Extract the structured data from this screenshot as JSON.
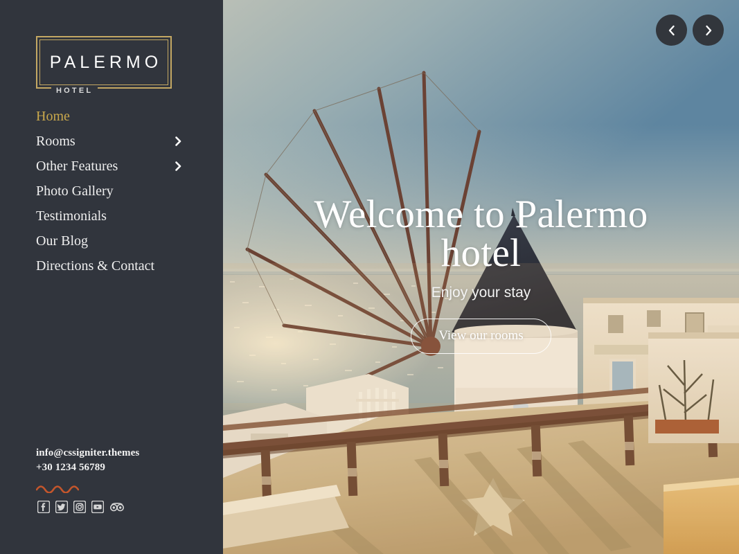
{
  "brand": {
    "name": "PALERMO",
    "sub": "HOTEL",
    "border_color": "#c4a863",
    "accent_gold": "#c9a84c",
    "sidebar_bg": "#31353d"
  },
  "nav": {
    "items": [
      {
        "label": "Home",
        "active": true,
        "has_submenu": false
      },
      {
        "label": "Rooms",
        "active": false,
        "has_submenu": true
      },
      {
        "label": "Other Features",
        "active": false,
        "has_submenu": true
      },
      {
        "label": "Photo Gallery",
        "active": false,
        "has_submenu": false
      },
      {
        "label": "Testimonials",
        "active": false,
        "has_submenu": false
      },
      {
        "label": "Our Blog",
        "active": false,
        "has_submenu": false
      },
      {
        "label": "Directions & Contact",
        "active": false,
        "has_submenu": false
      }
    ]
  },
  "contact": {
    "email": "info@cssigniter.themes",
    "phone": "+30 1234 56789",
    "divider_color": "#c4562c"
  },
  "socials": [
    {
      "name": "facebook-icon",
      "label": "Facebook"
    },
    {
      "name": "twitter-icon",
      "label": "Twitter"
    },
    {
      "name": "instagram-icon",
      "label": "Instagram"
    },
    {
      "name": "youtube-icon",
      "label": "YouTube"
    },
    {
      "name": "tripadvisor-icon",
      "label": "TripAdvisor"
    }
  ],
  "hero": {
    "title": "Welcome to Palermo hotel",
    "subtitle": "Enjoy your stay",
    "button_label": "View our rooms",
    "image_description": "Santorini windmill and whitewashed terrace overlooking a sunlit sea at golden hour"
  },
  "slider": {
    "prev_label": "Previous slide",
    "next_label": "Next slide",
    "button_bg": "#32363c"
  }
}
